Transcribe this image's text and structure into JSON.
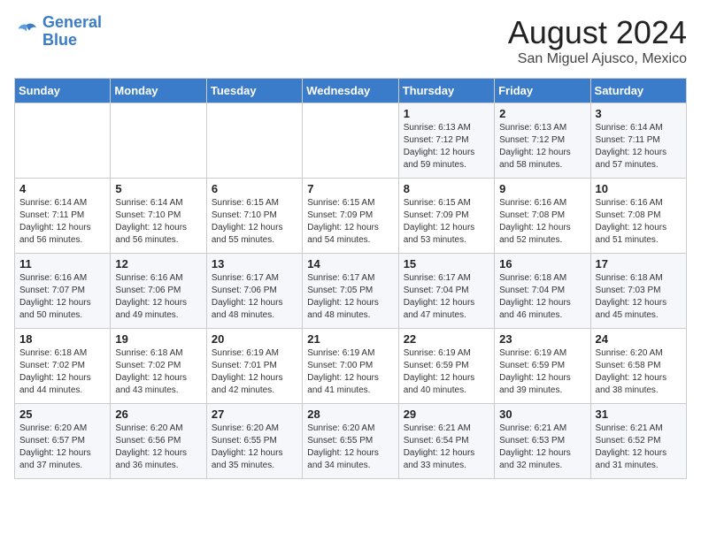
{
  "header": {
    "logo_general": "General",
    "logo_blue": "Blue",
    "month": "August 2024",
    "location": "San Miguel Ajusco, Mexico"
  },
  "days_of_week": [
    "Sunday",
    "Monday",
    "Tuesday",
    "Wednesday",
    "Thursday",
    "Friday",
    "Saturday"
  ],
  "weeks": [
    [
      {
        "day": "",
        "info": ""
      },
      {
        "day": "",
        "info": ""
      },
      {
        "day": "",
        "info": ""
      },
      {
        "day": "",
        "info": ""
      },
      {
        "day": "1",
        "info": "Sunrise: 6:13 AM\nSunset: 7:12 PM\nDaylight: 12 hours\nand 59 minutes."
      },
      {
        "day": "2",
        "info": "Sunrise: 6:13 AM\nSunset: 7:12 PM\nDaylight: 12 hours\nand 58 minutes."
      },
      {
        "day": "3",
        "info": "Sunrise: 6:14 AM\nSunset: 7:11 PM\nDaylight: 12 hours\nand 57 minutes."
      }
    ],
    [
      {
        "day": "4",
        "info": "Sunrise: 6:14 AM\nSunset: 7:11 PM\nDaylight: 12 hours\nand 56 minutes."
      },
      {
        "day": "5",
        "info": "Sunrise: 6:14 AM\nSunset: 7:10 PM\nDaylight: 12 hours\nand 56 minutes."
      },
      {
        "day": "6",
        "info": "Sunrise: 6:15 AM\nSunset: 7:10 PM\nDaylight: 12 hours\nand 55 minutes."
      },
      {
        "day": "7",
        "info": "Sunrise: 6:15 AM\nSunset: 7:09 PM\nDaylight: 12 hours\nand 54 minutes."
      },
      {
        "day": "8",
        "info": "Sunrise: 6:15 AM\nSunset: 7:09 PM\nDaylight: 12 hours\nand 53 minutes."
      },
      {
        "day": "9",
        "info": "Sunrise: 6:16 AM\nSunset: 7:08 PM\nDaylight: 12 hours\nand 52 minutes."
      },
      {
        "day": "10",
        "info": "Sunrise: 6:16 AM\nSunset: 7:08 PM\nDaylight: 12 hours\nand 51 minutes."
      }
    ],
    [
      {
        "day": "11",
        "info": "Sunrise: 6:16 AM\nSunset: 7:07 PM\nDaylight: 12 hours\nand 50 minutes."
      },
      {
        "day": "12",
        "info": "Sunrise: 6:16 AM\nSunset: 7:06 PM\nDaylight: 12 hours\nand 49 minutes."
      },
      {
        "day": "13",
        "info": "Sunrise: 6:17 AM\nSunset: 7:06 PM\nDaylight: 12 hours\nand 48 minutes."
      },
      {
        "day": "14",
        "info": "Sunrise: 6:17 AM\nSunset: 7:05 PM\nDaylight: 12 hours\nand 48 minutes."
      },
      {
        "day": "15",
        "info": "Sunrise: 6:17 AM\nSunset: 7:04 PM\nDaylight: 12 hours\nand 47 minutes."
      },
      {
        "day": "16",
        "info": "Sunrise: 6:18 AM\nSunset: 7:04 PM\nDaylight: 12 hours\nand 46 minutes."
      },
      {
        "day": "17",
        "info": "Sunrise: 6:18 AM\nSunset: 7:03 PM\nDaylight: 12 hours\nand 45 minutes."
      }
    ],
    [
      {
        "day": "18",
        "info": "Sunrise: 6:18 AM\nSunset: 7:02 PM\nDaylight: 12 hours\nand 44 minutes."
      },
      {
        "day": "19",
        "info": "Sunrise: 6:18 AM\nSunset: 7:02 PM\nDaylight: 12 hours\nand 43 minutes."
      },
      {
        "day": "20",
        "info": "Sunrise: 6:19 AM\nSunset: 7:01 PM\nDaylight: 12 hours\nand 42 minutes."
      },
      {
        "day": "21",
        "info": "Sunrise: 6:19 AM\nSunset: 7:00 PM\nDaylight: 12 hours\nand 41 minutes."
      },
      {
        "day": "22",
        "info": "Sunrise: 6:19 AM\nSunset: 6:59 PM\nDaylight: 12 hours\nand 40 minutes."
      },
      {
        "day": "23",
        "info": "Sunrise: 6:19 AM\nSunset: 6:59 PM\nDaylight: 12 hours\nand 39 minutes."
      },
      {
        "day": "24",
        "info": "Sunrise: 6:20 AM\nSunset: 6:58 PM\nDaylight: 12 hours\nand 38 minutes."
      }
    ],
    [
      {
        "day": "25",
        "info": "Sunrise: 6:20 AM\nSunset: 6:57 PM\nDaylight: 12 hours\nand 37 minutes."
      },
      {
        "day": "26",
        "info": "Sunrise: 6:20 AM\nSunset: 6:56 PM\nDaylight: 12 hours\nand 36 minutes."
      },
      {
        "day": "27",
        "info": "Sunrise: 6:20 AM\nSunset: 6:55 PM\nDaylight: 12 hours\nand 35 minutes."
      },
      {
        "day": "28",
        "info": "Sunrise: 6:20 AM\nSunset: 6:55 PM\nDaylight: 12 hours\nand 34 minutes."
      },
      {
        "day": "29",
        "info": "Sunrise: 6:21 AM\nSunset: 6:54 PM\nDaylight: 12 hours\nand 33 minutes."
      },
      {
        "day": "30",
        "info": "Sunrise: 6:21 AM\nSunset: 6:53 PM\nDaylight: 12 hours\nand 32 minutes."
      },
      {
        "day": "31",
        "info": "Sunrise: 6:21 AM\nSunset: 6:52 PM\nDaylight: 12 hours\nand 31 minutes."
      }
    ]
  ]
}
